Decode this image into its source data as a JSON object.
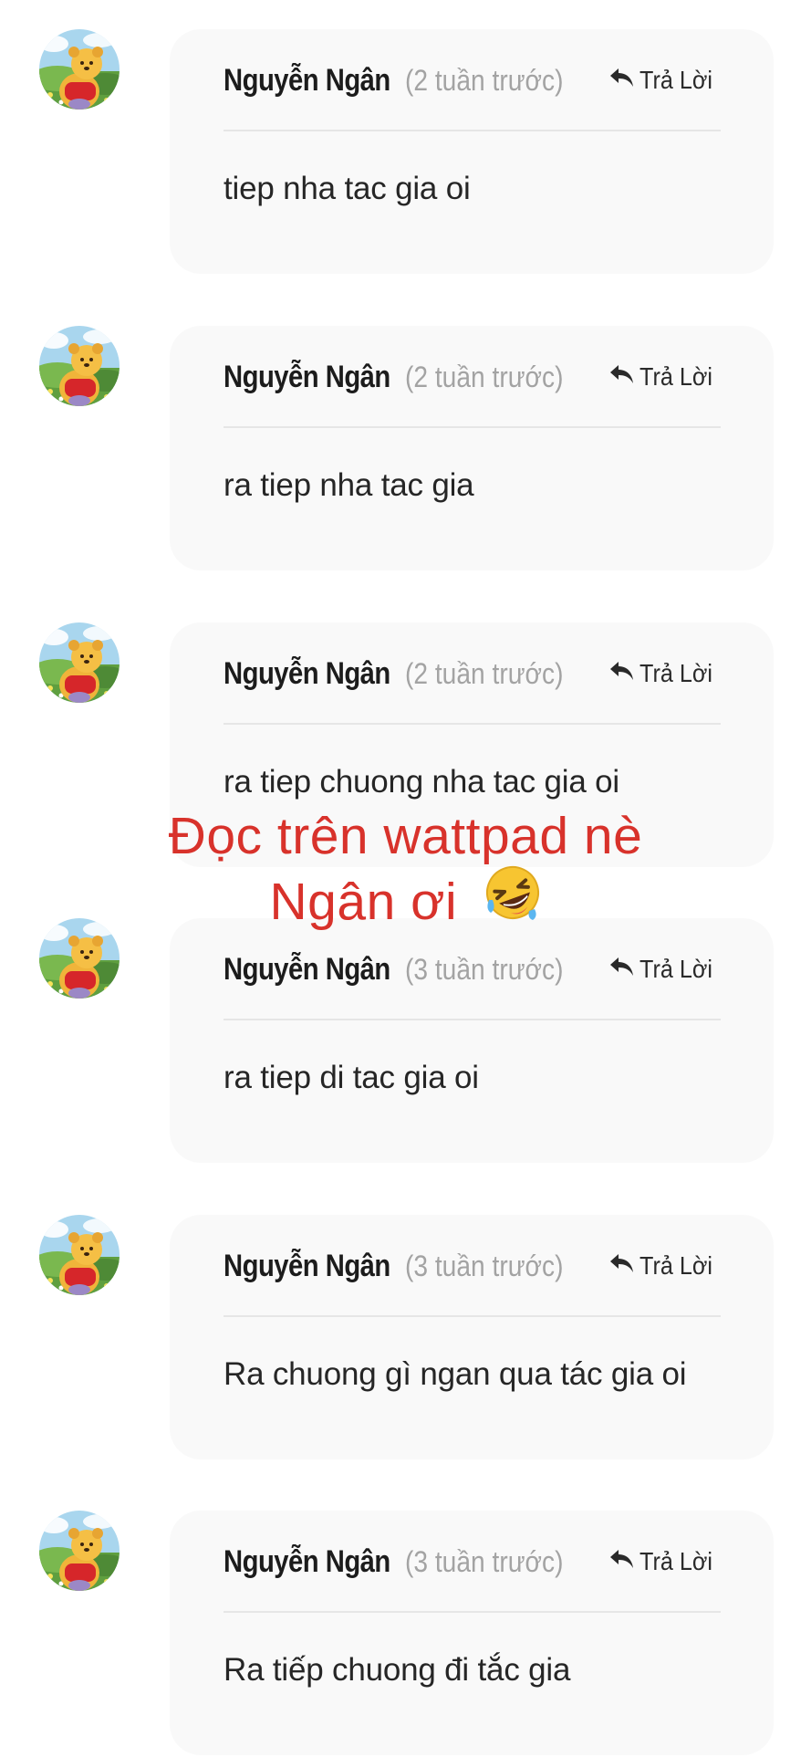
{
  "comments": [
    {
      "author": "Nguyễn Ngân",
      "time": "(2 tuần trước)",
      "reply": "Trả Lời",
      "text": "tiep nha tac gia oi"
    },
    {
      "author": "Nguyễn Ngân",
      "time": "(2 tuần trước)",
      "reply": "Trả Lời",
      "text": "ra tiep nha tac gia"
    },
    {
      "author": "Nguyễn Ngân",
      "time": "(2 tuần trước)",
      "reply": "Trả Lời",
      "text": "ra tiep chuong nha tac gia oi"
    },
    {
      "author": "Nguyễn Ngân",
      "time": "(3 tuần trước)",
      "reply": "Trả Lời",
      "text": "ra tiep di tac gia oi"
    },
    {
      "author": "Nguyễn Ngân",
      "time": "(3 tuần trước)",
      "reply": "Trả Lời",
      "text": "Ra chuong gì ngan qua tác gia oi"
    },
    {
      "author": "Nguyễn Ngân",
      "time": "(3 tuần trước)",
      "reply": "Trả Lời",
      "text": "Ra tiếp chuong đi tắc gia"
    }
  ],
  "overlay": {
    "line1": "Đọc trên wattpad nè",
    "line2": "Ngân ơi",
    "emoji": "rolling-on-floor-laughing-emoji",
    "color": "#d8322b"
  },
  "colors": {
    "bubble": "#f9f9f9",
    "time": "#a3a3a3",
    "author": "#1c1c1c"
  },
  "icons": {
    "reply": "reply-arrow-icon",
    "avatar": "pooh-avatar"
  }
}
